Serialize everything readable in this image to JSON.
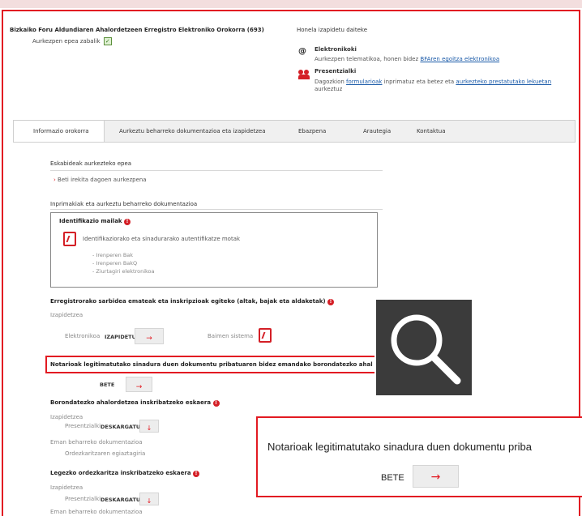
{
  "header": {
    "registry_title": "Bizkaiko Foru Aldundiaren Ahalordetzeen Erregistro Elektroniko Orokorra (693)",
    "open_status": "Aurkezpen epea zabalik",
    "submit_title": "Honela izapidetu daiteke",
    "electronic_title": "Elektronikoki",
    "electronic_text": "Aurkezpen telematikoa, honen bidez",
    "electronic_link": "BFAren egoitza elektronikoa",
    "inperson_title": "Presentzialki",
    "inperson_text_1": "Dagozkion",
    "inperson_link_1": "formularioak",
    "inperson_text_2": "inprimatuz eta betez eta",
    "inperson_link_2": "aurkezteko prestatutako lekuetan",
    "inperson_text_3": "aurkeztuz"
  },
  "tabs": [
    {
      "label": "Informazio orokorra"
    },
    {
      "label": "Aurkeztu beharreko dokumentazioa eta izapidetzea"
    },
    {
      "label": "Ebazpena"
    },
    {
      "label": "Arautegia"
    },
    {
      "label": "Kontaktua"
    }
  ],
  "content": {
    "deadline_title": "Eskabideak aurkezteko epea",
    "deadline_item": "Beti irekita dagoen aurkezpena",
    "forms_title": "Inprimakiak eta aurkeztu beharreko dokumentazioa",
    "id_levels_title": "Identifikazio mailak",
    "id_levels_doc": "Identifikaziorako eta sinadurarako autentifikatze motak",
    "id_levels_items": [
      "- Irenperen Bak",
      "- Irenperen BakQ",
      "- Ziurtagiri elektronikoa"
    ],
    "access_title": "Erregistrorako sarbidea emateak eta inskripzioak egiteko (altak, bajak eta aldaketak)",
    "izapidetzea": "Izapidetzea",
    "elektronikoa": "Elektronikoa",
    "izapidetu": "IZAPIDETU",
    "baimen_sistema": "Baimen sistema",
    "notary_title": "Notarioak legitimatutako sinadura duen dokumentu pribatuaren bidez emandako borondatezko ahalordetze",
    "bete": "BETE",
    "voluntary_title": "Borondatezko ahalordetzea inskribatzeko eskaera",
    "izapidetzea_2": "Izapidetzea",
    "presentzialki": "Presentzialki",
    "deskargatu": "DESKARGATU",
    "eman_doc": "Eman beharreko dokumentazioa",
    "ordezkaritza": "Ordezkaritzaren egiaztagiria",
    "legal_title": "Legezko ordezkaritza inskribatzeko eskaera",
    "izapidetzea_3": "Izapidetzea",
    "presentzialki_2": "Presentzialki",
    "deskargatu_2": "DESKARGATU",
    "eman_doc_2": "Eman beharreko dokumentazioa"
  },
  "zoom": {
    "text": "Notarioak legitimatutako sinadura duen dokumentu priba",
    "bete": "BETE"
  }
}
